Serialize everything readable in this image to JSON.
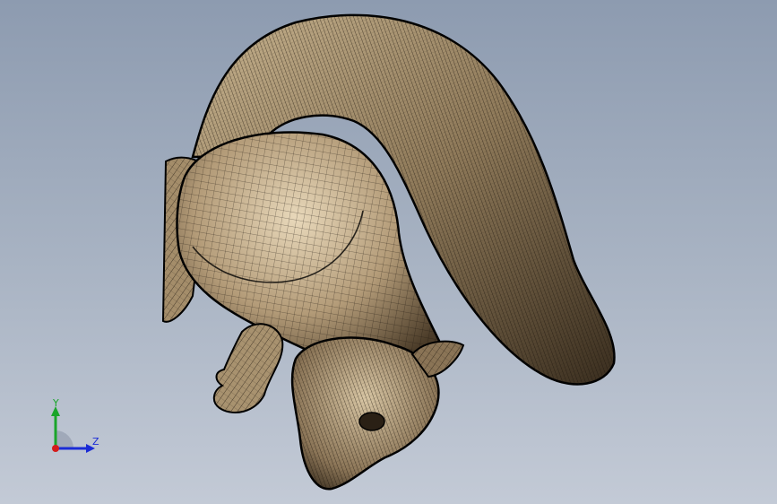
{
  "viewport": {
    "model_name": "",
    "render_mode": "wireframe-shaded",
    "colors": {
      "background_top": "#8d9bb0",
      "background_bottom": "#c3cad6",
      "model_fill": "#b9a27e",
      "model_highlight": "#e2d2b4",
      "mesh_line": "#1b140c"
    }
  },
  "triad": {
    "y_label": "Y",
    "z_label": "Z",
    "colors": {
      "x": "#d41c1c",
      "y": "#1aa52a",
      "z": "#1a2bd6"
    }
  }
}
